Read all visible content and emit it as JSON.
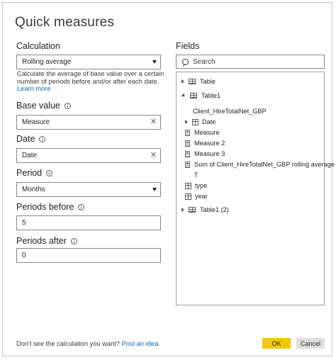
{
  "dialog": {
    "title": "Quick measures",
    "calculation": {
      "label": "Calculation",
      "value": "Rolling average",
      "description": "Calculate the average of base value over a certain number of periods before and/or after each date.",
      "learn_more": "Learn more"
    },
    "base_value": {
      "label": "Base value",
      "value": "Measure"
    },
    "date": {
      "label": "Date",
      "value": "Date"
    },
    "period": {
      "label": "Period",
      "value": "Months"
    },
    "periods_before": {
      "label": "Periods before",
      "value": "5"
    },
    "periods_after": {
      "label": "Periods after",
      "value": "0"
    },
    "fields": {
      "label": "Fields",
      "search_placeholder": "Search",
      "items": [
        {
          "label": "Table"
        },
        {
          "label": "Table1"
        },
        {
          "label": "Client_HireTotalNet_GBP"
        },
        {
          "label": "Date"
        },
        {
          "label": "Measure"
        },
        {
          "label": "Measure 2"
        },
        {
          "label": "Measure 3"
        },
        {
          "label": "Sum of Client_HireTotalNet_GBP rolling average"
        },
        {
          "label": "T"
        },
        {
          "label": "type"
        },
        {
          "label": "year"
        },
        {
          "label": "Table1 (2)"
        }
      ]
    },
    "footer": {
      "prompt": "Don't see the calculation you want?",
      "link": "Post an idea."
    },
    "ok_label": "OK",
    "cancel_label": "Cancel"
  }
}
